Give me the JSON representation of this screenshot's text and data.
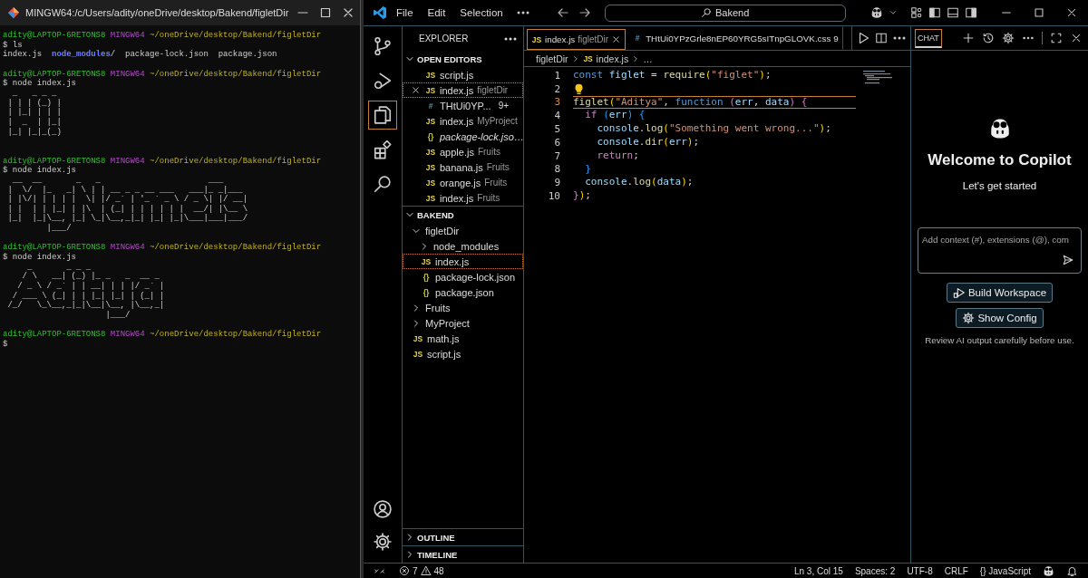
{
  "terminal": {
    "title": "MINGW64:/c/Users/adity/oneDrive/desktop/Bakend/figletDir",
    "lines": [
      {
        "kind": "prompt",
        "user": "adity@LAPTOP-6RETONS8",
        "shell": "MINGW64",
        "path": "~/oneDrive/desktop/Bakend/figletDir"
      },
      {
        "kind": "command",
        "text": "$ ls"
      },
      {
        "kind": "listing",
        "entries": [
          {
            "name": "index.js",
            "kind": "file"
          },
          {
            "name": "node_modules",
            "suffix": "/",
            "kind": "dir"
          },
          {
            "name": "package-lock.json",
            "kind": "file"
          },
          {
            "name": "package.json",
            "kind": "file"
          }
        ]
      },
      {
        "kind": "blank"
      },
      {
        "kind": "prompt",
        "user": "adity@LAPTOP-6RETONS8",
        "shell": "MINGW64",
        "path": "~/oneDrive/desktop/Bakend/figletDir"
      },
      {
        "kind": "command",
        "text": "$ node index.js"
      },
      {
        "kind": "art",
        "rows": [
          " _   _ _ _",
          "| | | (_) |",
          "| |_| | | |",
          "|  _  | |_|",
          "|_| |_|_(_)"
        ]
      },
      {
        "kind": "blank"
      },
      {
        "kind": "blank"
      },
      {
        "kind": "prompt",
        "user": "adity@LAPTOP-6RETONS8",
        "shell": "MINGW64",
        "path": "~/oneDrive/desktop/Bakend/figletDir"
      },
      {
        "kind": "command",
        "text": "$ node index.js"
      },
      {
        "kind": "art",
        "rows": [
          " __  __       _   _                      ___",
          "|  \\/  |_   _| \\ | | __ _ _ __ ___   ___|_ _|___",
          "| |\\/| | | | |  \\| |/ _` | '_ ` _ \\ / _ \\| |/ __|",
          "| |  | | |_| | |\\  | (_| | | | | | |  __/| |\\__ \\",
          "|_|  |_|\\__, |_| \\_|\\__,_|_| |_| |_|\\___|___|___/",
          "        |___/"
        ]
      },
      {
        "kind": "blank"
      },
      {
        "kind": "prompt",
        "user": "adity@LAPTOP-6RETONS8",
        "shell": "MINGW64",
        "path": "~/oneDrive/desktop/Bakend/figletDir"
      },
      {
        "kind": "command",
        "text": "$ node index.js"
      },
      {
        "kind": "art",
        "rows": [
          "    _       _ _ _",
          "   / \\   __| (_) |_ _   _  __ _",
          "  / _ \\ / _` | | __| | | |/ _` |",
          " / ___ \\ (_| | | |_| |_| | (_| |",
          "/_/   \\_\\__,_|_|\\__|\\__, |\\__,_|",
          "                    |___/"
        ]
      },
      {
        "kind": "blank"
      },
      {
        "kind": "prompt",
        "user": "adity@LAPTOP-6RETONS8",
        "shell": "MINGW64",
        "path": "~/oneDrive/desktop/Bakend/figletDir"
      },
      {
        "kind": "command",
        "text": "$"
      }
    ]
  },
  "vscode": {
    "menu": [
      "File",
      "Edit",
      "Selection"
    ],
    "command_center": "Bakend",
    "activity": [
      {
        "kind": "source-control",
        "selected": false
      },
      {
        "kind": "debug",
        "selected": false
      },
      {
        "kind": "explorer",
        "selected": true
      },
      {
        "kind": "extensions",
        "selected": false
      },
      {
        "kind": "search",
        "selected": false
      }
    ],
    "explorer": {
      "title": "EXPLORER",
      "open_editors": {
        "title": "OPEN EDITORS",
        "expanded": true,
        "items": [
          {
            "glyph": "JS",
            "kind": "js",
            "name": "script.js",
            "selected": false,
            "preview": false
          },
          {
            "glyph": "JS",
            "kind": "js",
            "name": "index.js",
            "detail": "figletDir",
            "selected": true,
            "preview": false
          },
          {
            "glyph": "#",
            "kind": "css",
            "name": "THtUi0YP...",
            "badge": "9+",
            "selected": false,
            "preview": false
          },
          {
            "glyph": "JS",
            "kind": "js",
            "name": "index.js",
            "detail": "MyProject",
            "selected": false,
            "preview": false
          },
          {
            "glyph": "{}",
            "kind": "json",
            "name": "package-lock.jso…",
            "selected": false,
            "preview": true
          },
          {
            "glyph": "JS",
            "kind": "js",
            "name": "apple.js",
            "detail": "Fruits",
            "selected": false,
            "preview": false
          },
          {
            "glyph": "JS",
            "kind": "js",
            "name": "banana.js",
            "detail": "Fruits",
            "selected": false,
            "preview": false
          },
          {
            "glyph": "JS",
            "kind": "js",
            "name": "orange.js",
            "detail": "Fruits",
            "selected": false,
            "preview": false
          },
          {
            "glyph": "JS",
            "kind": "js",
            "name": "index.js",
            "detail": "Fruits",
            "selected": false,
            "preview": false
          }
        ]
      },
      "folder": {
        "title": "BAKEND",
        "expanded": true,
        "children": [
          {
            "name": "figletDir",
            "kind": "folder",
            "expanded": true,
            "selected": false,
            "children": [
              {
                "name": "node_modules",
                "kind": "folder",
                "expanded": false,
                "selected": false
              },
              {
                "name": "index.js",
                "kind": "js",
                "glyph": "JS",
                "selected": true
              },
              {
                "name": "package-lock.json",
                "kind": "json",
                "glyph": "{}",
                "selected": false
              },
              {
                "name": "package.json",
                "kind": "json",
                "glyph": "{}",
                "selected": false
              }
            ]
          },
          {
            "name": "Fruits",
            "kind": "folder",
            "expanded": false,
            "selected": false
          },
          {
            "name": "MyProject",
            "kind": "folder",
            "expanded": false,
            "selected": false
          },
          {
            "name": "math.js",
            "kind": "js",
            "glyph": "JS",
            "selected": false
          },
          {
            "name": "script.js",
            "kind": "js",
            "glyph": "JS",
            "selected": false
          }
        ]
      },
      "sections": [
        {
          "title": "OUTLINE",
          "expanded": false
        },
        {
          "title": "TIMELINE",
          "expanded": false
        }
      ]
    },
    "tabs": [
      {
        "glyph": "JS",
        "kind": "js",
        "label": "index.js",
        "detail": "figletDir",
        "selected": true
      },
      {
        "glyph": "#",
        "kind": "css",
        "label": "THtUi0YPzGrle8nEP60YRG5sITnpGLOVK.css",
        "badge": "9",
        "selected": false
      }
    ],
    "breadcrumb": [
      {
        "label": "figletDir"
      },
      {
        "label": "index.js",
        "glyph": "JS",
        "kind": "js"
      },
      {
        "label": "…"
      }
    ],
    "code": [
      {
        "number": "1",
        "current": false,
        "tokens": [
          {
            "text": "const ",
            "kind": "kw"
          },
          {
            "text": "figlet",
            "kind": "var"
          },
          {
            "text": " = ",
            "kind": "plain"
          },
          {
            "text": "require",
            "kind": "fn"
          },
          {
            "text": "(",
            "kind": "p1"
          },
          {
            "text": "\"figlet\"",
            "kind": "str"
          },
          {
            "text": ")",
            "kind": "p1"
          },
          {
            "text": ";",
            "kind": "plain"
          }
        ]
      },
      {
        "number": "2",
        "current": false,
        "lightbulb": true
      },
      {
        "number": "3",
        "current": true,
        "tokens": [
          {
            "text": "figlet",
            "kind": "fn"
          },
          {
            "text": "(",
            "kind": "p1"
          },
          {
            "text": "\"Aditya\"",
            "kind": "str"
          },
          {
            "text": ", ",
            "kind": "plain"
          },
          {
            "text": "function ",
            "kind": "kw"
          },
          {
            "text": "(",
            "kind": "p2"
          },
          {
            "text": "err",
            "kind": "var"
          },
          {
            "text": ", ",
            "kind": "plain"
          },
          {
            "text": "data",
            "kind": "var"
          },
          {
            "text": ")",
            "kind": "p2"
          },
          {
            "text": " {",
            "kind": "p2"
          }
        ]
      },
      {
        "number": "4",
        "current": false,
        "tokens": [
          {
            "text": "  if ",
            "kind": "ctrl"
          },
          {
            "text": "(",
            "kind": "p3"
          },
          {
            "text": "err",
            "kind": "var"
          },
          {
            "text": ")",
            "kind": "p3"
          },
          {
            "text": " {",
            "kind": "p3"
          }
        ]
      },
      {
        "number": "5",
        "current": false,
        "tokens": [
          {
            "text": "    console",
            "kind": "var"
          },
          {
            "text": ".",
            "kind": "plain"
          },
          {
            "text": "log",
            "kind": "fn"
          },
          {
            "text": "(",
            "kind": "p1"
          },
          {
            "text": "\"Something went wrong...\"",
            "kind": "str"
          },
          {
            "text": ")",
            "kind": "p1"
          },
          {
            "text": ";",
            "kind": "plain"
          }
        ]
      },
      {
        "number": "6",
        "current": false,
        "tokens": [
          {
            "text": "    console",
            "kind": "var"
          },
          {
            "text": ".",
            "kind": "plain"
          },
          {
            "text": "dir",
            "kind": "fn"
          },
          {
            "text": "(",
            "kind": "p1"
          },
          {
            "text": "err",
            "kind": "var"
          },
          {
            "text": ")",
            "kind": "p1"
          },
          {
            "text": ";",
            "kind": "plain"
          }
        ]
      },
      {
        "number": "7",
        "current": false,
        "tokens": [
          {
            "text": "    return",
            "kind": "ctrl"
          },
          {
            "text": ";",
            "kind": "plain"
          }
        ]
      },
      {
        "number": "8",
        "current": false,
        "tokens": [
          {
            "text": "  }",
            "kind": "p3"
          }
        ]
      },
      {
        "number": "9",
        "current": false,
        "tokens": [
          {
            "text": "  console",
            "kind": "var"
          },
          {
            "text": ".",
            "kind": "plain"
          },
          {
            "text": "log",
            "kind": "fn"
          },
          {
            "text": "(",
            "kind": "p1"
          },
          {
            "text": "data",
            "kind": "var"
          },
          {
            "text": ")",
            "kind": "p1"
          },
          {
            "text": ";",
            "kind": "plain"
          }
        ]
      },
      {
        "number": "10",
        "current": false,
        "tokens": [
          {
            "text": "}",
            "kind": "p2"
          },
          {
            "text": ")",
            "kind": "p1"
          },
          {
            "text": ";",
            "kind": "plain"
          }
        ]
      }
    ],
    "chat": {
      "tabs": [
        {
          "label": "CHAT",
          "selected": true
        }
      ],
      "title": "Welcome to Copilot",
      "subtitle": "Let's get started",
      "input": {
        "placeholder": "Add context (#), extensions (@), com"
      },
      "buttons": [
        {
          "label": "Build Workspace",
          "kind": "workspace"
        },
        {
          "label": "Show Config",
          "kind": "config"
        }
      ],
      "note": "Review AI output carefully before use."
    },
    "status": {
      "errors": "7",
      "warnings": "48",
      "items": [
        "Ln 3, Col 15",
        "Spaces: 2",
        "UTF-8",
        "CRLF"
      ],
      "language": {
        "glyph": "{}",
        "label": "JavaScript"
      }
    }
  }
}
